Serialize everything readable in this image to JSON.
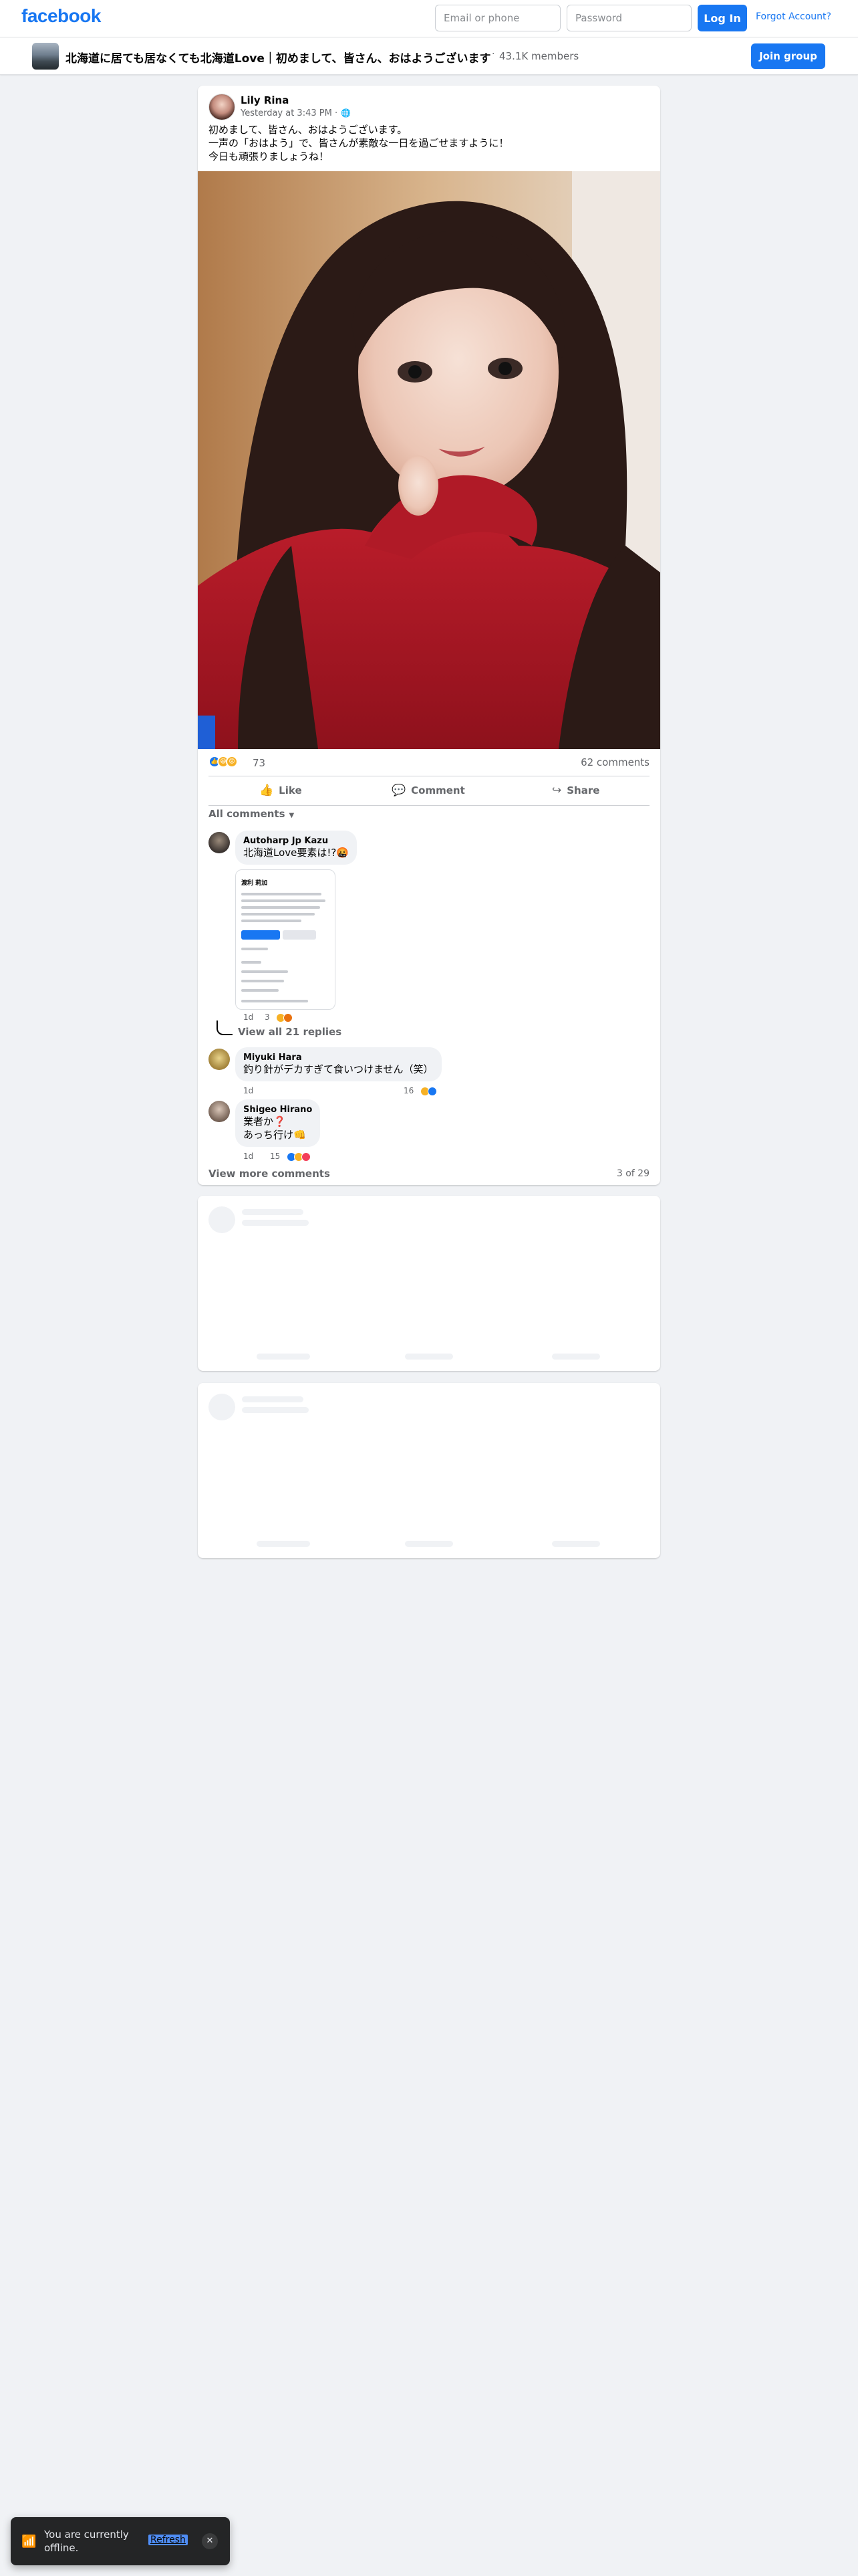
{
  "header": {
    "logo": "facebook",
    "email_placeholder": "Email or phone",
    "password_placeholder": "Password",
    "login_label": "Log In",
    "forgot_label": "Forgot Account?"
  },
  "group": {
    "name": "北海道に居ても居なくても北海道Love｜初めまして、皆さん、おはようございます",
    "separator": "·",
    "members": "43.1K members",
    "join_label": "Join group"
  },
  "post": {
    "author": "Lily Rina",
    "time": "Yesterday at 3:43 PM ·",
    "privacy_icon": "globe-icon",
    "text_lines": [
      "初めまして、皆さん、おはようございます。",
      "一声の「おはよう」で、皆さんが素敵な一日を過ごせますように！",
      "今日も頑張りましょうね！"
    ],
    "reaction_count": "73",
    "comment_count": "62 comments",
    "actions": {
      "like": "Like",
      "comment": "Comment",
      "share": "Share"
    },
    "filter_label": "All comments",
    "comments": [
      {
        "author": "Autoharp Jp Kazu",
        "text": "北海道Love要素は!?🤬",
        "time": "1d",
        "reactions": "3",
        "attachment_title": "渡利 莉加",
        "view_replies": "View all 21 replies"
      },
      {
        "author": "Miyuki Hara",
        "text": "釣り針がデカすぎて食いつけません（笑）",
        "time": "1d",
        "reactions": "16"
      },
      {
        "author": "Shigeo Hirano",
        "text_lines": [
          "業者か❓",
          "あっち行け👊"
        ],
        "time": "1d",
        "reactions": "15"
      }
    ],
    "view_more": "View more comments",
    "pagination": "3 of 29"
  },
  "toast": {
    "text": "You are currently offline.",
    "refresh": "Refresh",
    "close_icon": "close-icon"
  },
  "colors": {
    "brand": "#1877f2",
    "background": "#f0f2f5",
    "muted_text": "#65676b"
  }
}
